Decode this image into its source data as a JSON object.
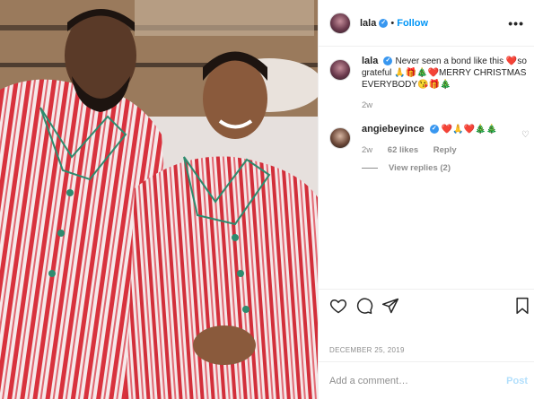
{
  "post": {
    "author": "lala",
    "follow_label": "Follow",
    "separator": "•",
    "more_label": "•••",
    "photo_alt": "Two people in matching red and white striped pajamas"
  },
  "caption": {
    "user": "lala",
    "text": "Never seen a bond like this ❤️so grateful 🙏🎁🎄❤️MERRY CHRISTMAS EVERYBODY😘🎁🎄",
    "age": "2w"
  },
  "comment": {
    "user": "angiebeyince",
    "text": "❤️🙏❤️🎄🎄",
    "age": "2w",
    "likes": "62 likes",
    "reply_label": "Reply",
    "view_replies": "View replies (2)"
  },
  "date": "DECEMBER 25, 2019",
  "add_comment": {
    "placeholder": "Add a comment…",
    "post_label": "Post"
  },
  "icons": [
    "heart-icon",
    "comment-icon",
    "share-icon",
    "bookmark-icon",
    "verified-icon"
  ],
  "colors": {
    "accent": "#0095f6",
    "post_disabled": "#b2dffc",
    "verified": "#3897f0",
    "pajama_red": "#d8323d"
  }
}
